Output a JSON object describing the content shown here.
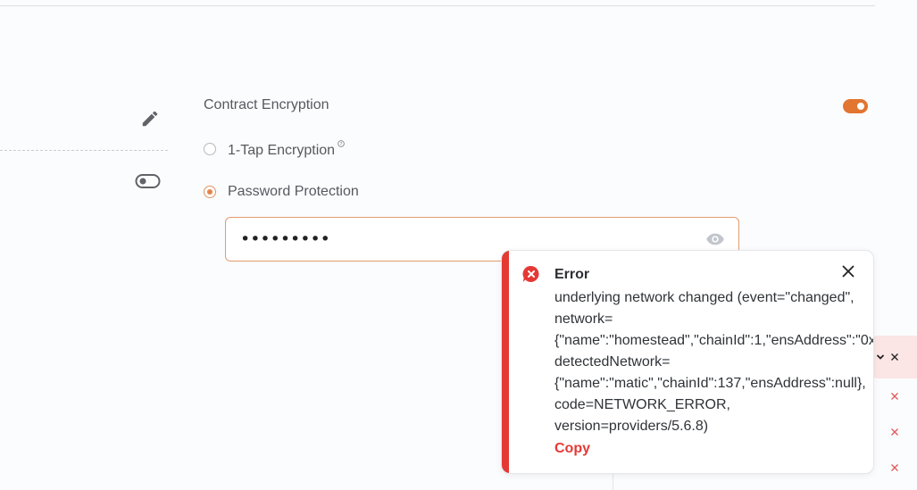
{
  "settings": {
    "contract_encryption_label": "Contract Encryption",
    "contract_encryption_enabled": true,
    "options": [
      {
        "label": "1-Tap Encryption",
        "selected": false
      },
      {
        "label": "Password Protection",
        "selected": true
      }
    ],
    "password_value": "•••••••••"
  },
  "toast": {
    "title": "Error",
    "message_lines": [
      "underlying network changed (event=\"changed\",",
      "network=",
      "{\"name\":\"homestead\",\"chainId\":1,\"ensAddress\":\"0x",
      "detectedNetwork=",
      "{\"name\":\"matic\",\"chainId\":137,\"ensAddress\":null},",
      "code=NETWORK_ERROR,",
      "version=providers/5.6.8)"
    ],
    "copy_label": "Copy"
  },
  "colors": {
    "accent": "#e27530",
    "error": "#e53935"
  },
  "icons": {
    "left_top": "pencil-icon",
    "left_bottom": "toggle-off-icon",
    "password_reveal": "eye-icon",
    "toast": "error-circle-icon",
    "toast_close": "close-icon"
  }
}
